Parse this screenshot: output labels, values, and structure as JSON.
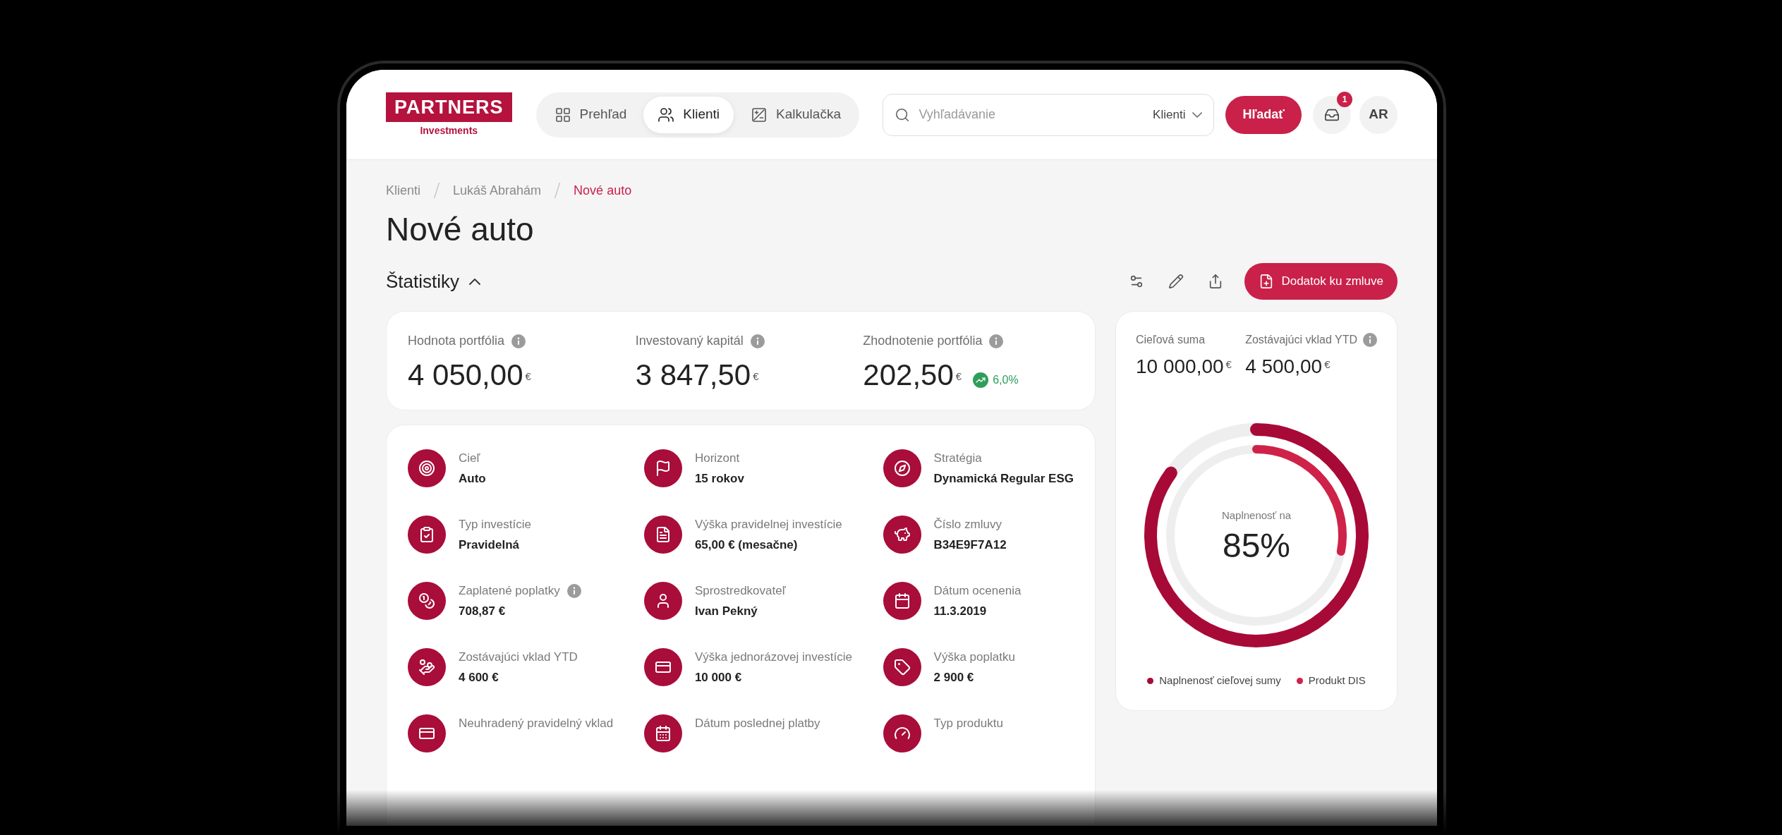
{
  "logo": {
    "name": "PARTNERS",
    "subtitle": "Investments"
  },
  "tabs": [
    {
      "label": "Prehľad",
      "selected": false
    },
    {
      "label": "Klienti",
      "selected": true
    },
    {
      "label": "Kalkulačka",
      "selected": false
    }
  ],
  "search": {
    "placeholder": "Vyhľadávanie",
    "scope": "Klienti",
    "button": "Hľadať"
  },
  "notifications": {
    "count": "1"
  },
  "avatar": {
    "initials": "AR"
  },
  "breadcrumb": [
    {
      "label": "Klienti",
      "current": false
    },
    {
      "label": "Lukáš Abrahám",
      "current": false
    },
    {
      "label": "Nové auto",
      "current": true
    }
  ],
  "title": "Nové auto",
  "section": {
    "title": "Štatistiky",
    "expanded": true
  },
  "actions": {
    "primary": "Dodatok ku zmluve"
  },
  "stats": [
    {
      "label": "Hodnota portfólia",
      "value": "4 050,00$^{€}$",
      "info": true
    },
    {
      "label": "Investovaný kapitál",
      "value": "3 847,50$^{€}$",
      "info": true
    },
    {
      "label": "Zhodnotenie portfólia",
      "value": "202,50$^{€}$",
      "info": true,
      "change": {
        "value": "6,0%",
        "positive": true
      }
    }
  ],
  "details": [
    {
      "label": "Cieľ",
      "value": "Auto"
    },
    {
      "label": "Horizont",
      "value": "15 rokov"
    },
    {
      "label": "Stratégia",
      "value": "Dynamická Regular ESG"
    },
    {
      "label": "Typ investície",
      "value": "Pravidelná"
    },
    {
      "label": "Výška pravidelnej investície",
      "value": "65,00 € (mesačne)"
    },
    {
      "label": "Číslo zmluvy",
      "value": "B34E9F7A12"
    },
    {
      "label": "Zaplatené poplatky",
      "value": "708,87 €",
      "info": true
    },
    {
      "label": "Sprostredkovateľ",
      "value": "Ivan Pekný"
    },
    {
      "label": "Dátum ocenenia",
      "value": "11.3.2019"
    },
    {
      "label": "Zostávajúci vklad YTD",
      "value": "4 600 €"
    },
    {
      "label": "Výška jednorázovej investície",
      "value": "10 000 €"
    },
    {
      "label": "Výška poplatku",
      "value": "2 900 €"
    },
    {
      "label": "Neuhradený pravidelný vklad"
    },
    {
      "label": "Dátum poslednej platby"
    },
    {
      "label": "Typ produktu"
    }
  ],
  "goal": {
    "metrics": [
      {
        "label": "Cieľová suma",
        "value": "10 000,00$^{€}$"
      },
      {
        "label": "Zostávajúci vklad YTD",
        "value": "4 500,00$^{€}$",
        "info": true
      }
    ],
    "center_label": "Naplnenosť na",
    "center_value": "85%",
    "rings": [
      {
        "label": "Naplnenosť cieľovej sumy",
        "color": "#a80a37",
        "level": 0.85
      },
      {
        "label": "Produkt DIS",
        "color": "#cf2249",
        "level": 0.28
      }
    ]
  }
}
